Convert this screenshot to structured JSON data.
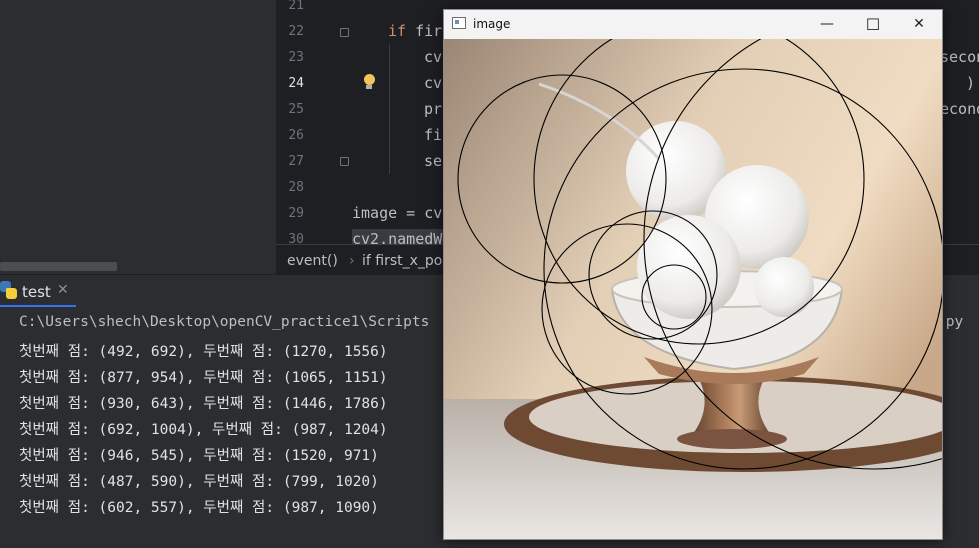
{
  "editor": {
    "lines": [
      {
        "num": "21",
        "text": ""
      },
      {
        "num": "22",
        "kw": "if",
        "text": " fir"
      },
      {
        "num": "23",
        "text": "cv"
      },
      {
        "num": "24",
        "text": "cv"
      },
      {
        "num": "25",
        "text": "pr"
      },
      {
        "num": "26",
        "text": "fi"
      },
      {
        "num": "27",
        "text": "se"
      },
      {
        "num": "28",
        "text": ""
      },
      {
        "num": "29",
        "text": "image = cv"
      },
      {
        "num": "30",
        "text": "cv2.namedW"
      }
    ],
    "overflow_right": {
      "line23": "secon",
      "line24": ")",
      "line25": "econd"
    }
  },
  "breadcrumb": {
    "item1": "event()",
    "sep": "›",
    "item2": "if first_x_po"
  },
  "run": {
    "tab_label": "test",
    "tab_close": "✕",
    "path_line": "C:\\Users\\shech\\Desktop\\openCV_practice1\\Scripts",
    "path_tail": ".py",
    "output": [
      "첫번째 점: (492, 692), 두번째 점: (1270, 1556)",
      "첫번째 점: (877, 954), 두번째 점: (1065, 1151)",
      "첫번째 점: (930, 643), 두번째 점: (1446, 1786)",
      "첫번째 점: (692, 1004), 두번째 점: (987, 1204)",
      "첫번째 점: (946, 545), 두번째 점: (1520, 971)",
      "첫번째 점: (487, 590), 두번째 점: (799, 1020)",
      "첫번째 점: (602, 557), 두번째 점: (987, 1090)"
    ]
  },
  "window": {
    "title": "image",
    "minimize": "—",
    "maximize": "☐",
    "close": "✕"
  },
  "colors": {
    "editor_bg": "#1e1f22",
    "panel_bg": "#2b2d30",
    "keyword": "#cf8e6d",
    "text": "#dfe1e5",
    "accent": "#3574f0"
  }
}
